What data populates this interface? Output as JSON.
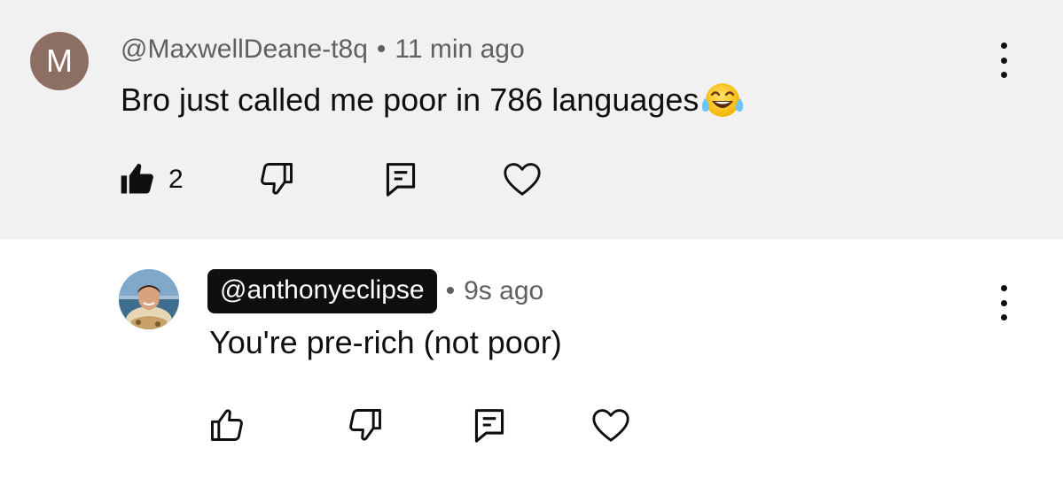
{
  "comments": [
    {
      "avatar_letter": "M",
      "avatar_color": "#8d6e63",
      "handle": "@MaxwellDeane-t8q",
      "separator": "•",
      "time": "11 min ago",
      "text": "Bro just called me poor in 786 languages",
      "emoji": "face-with-tears-of-joy",
      "likes": "2",
      "liked": true,
      "icons": [
        "thumbs-up-filled-icon",
        "thumbs-down-icon",
        "reply-icon",
        "heart-icon",
        "more-vert-icon"
      ]
    },
    {
      "avatar": "profile-photo",
      "handle": "@anthonyeclipse",
      "handle_highlighted": true,
      "separator": "•",
      "time": "9s ago",
      "text": "You're pre-rich (not poor)",
      "liked": false,
      "icons": [
        "thumbs-up-icon",
        "thumbs-down-icon",
        "reply-icon",
        "heart-icon",
        "more-vert-icon"
      ]
    }
  ],
  "colors": {
    "highlight_bg": "#f1f1f1",
    "meta_text": "#606060",
    "handle_pill": "#0f0f0f"
  }
}
